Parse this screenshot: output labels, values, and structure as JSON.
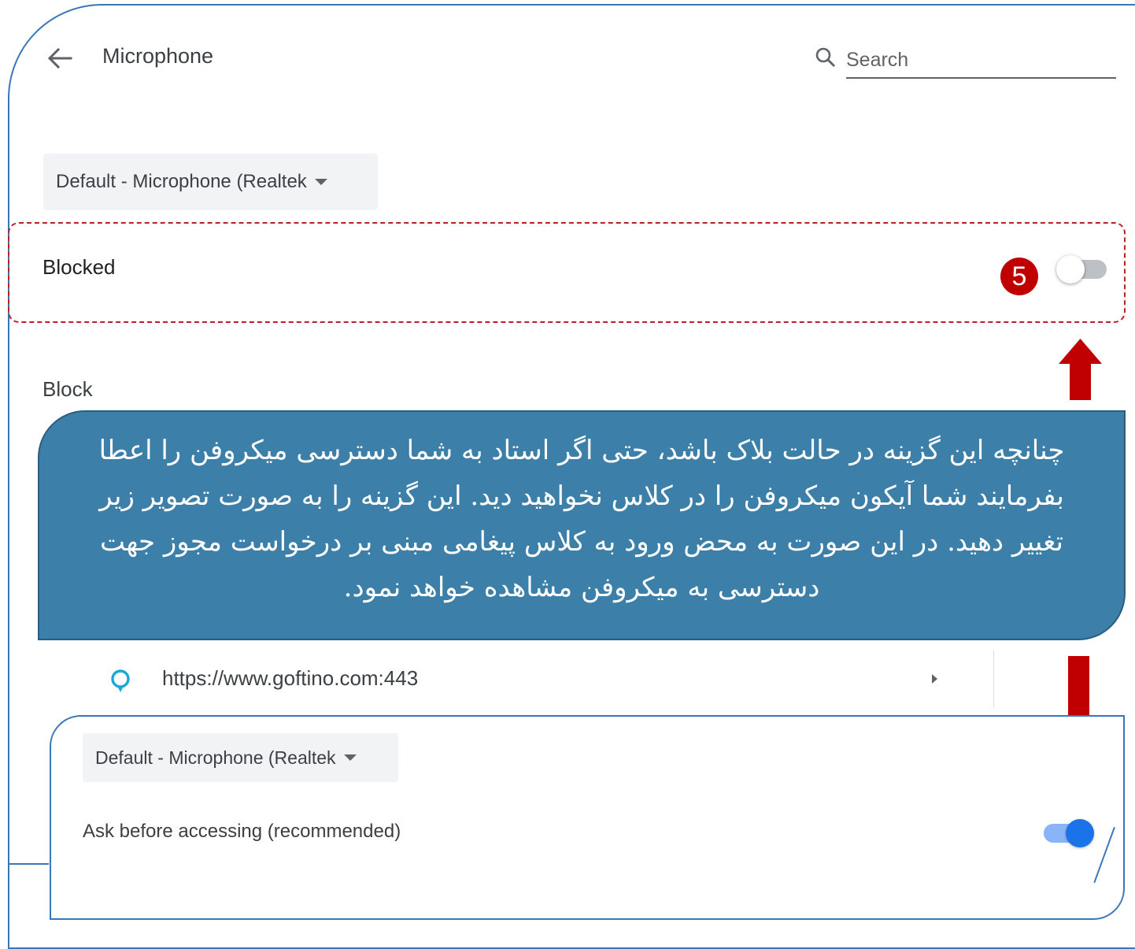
{
  "header": {
    "title": "Microphone",
    "search_placeholder": "Search"
  },
  "device_select": {
    "value": "Default - Microphone (Realtek"
  },
  "blocked_setting": {
    "label": "Blocked",
    "step_number": "5",
    "toggle_on": false
  },
  "block_section": {
    "heading": "Block",
    "sites": [
      {
        "url": "https://www.goftino.com:443"
      }
    ]
  },
  "callout": {
    "text": "چنانچه این گزینه در حالت بلاک باشد، حتی اگر استاد به شما دسترسی میکروفن را اعطا بفرمایند شما آیکون میکروفن را در کلاس نخواهید دید. این گزینه را به صورت تصویر زیر تغییر دهید. در این صورت به محض ورود به کلاس پیغامی مبنی بر درخواست مجوز جهت دسترسی به میکروفن مشاهده خواهد نمود."
  },
  "after_panel": {
    "device_select_value": "Default - Microphone (Realtek",
    "label": "Ask before accessing (recommended)",
    "toggle_on": true
  },
  "colors": {
    "accent_blue": "#1a73e8",
    "callout_bg": "#3c7fa9",
    "highlight_red": "#c00000",
    "frame_blue": "#3a77b8"
  }
}
